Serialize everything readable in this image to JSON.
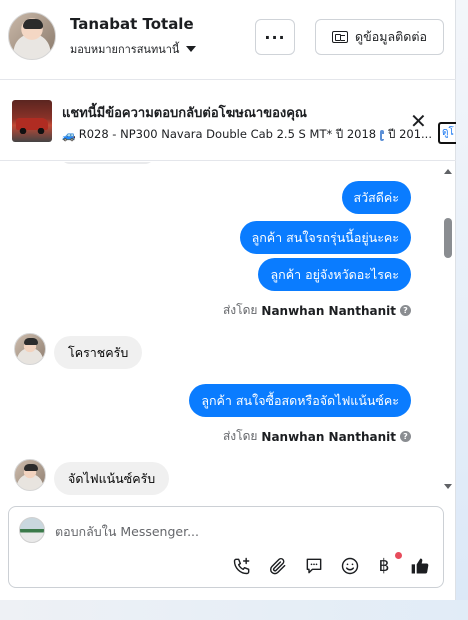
{
  "header": {
    "contact_name": "Tanabat Totale",
    "assign_label": "มอบหมายการสนทนานี้",
    "more_label": "···",
    "contact_info_label": "ดูข้อมูลติดต่อ"
  },
  "ad_banner": {
    "title": "แชทนี้มีข้อความตอบกลับต่อโฆษณาของคุณ",
    "car_emoji": "🚙",
    "detail_main": "R028 - NP300 Navara Double Cab 2.5 S MT* ปี 2018",
    "detail_tail": "ปี 201...",
    "more_tab_label": "ดูโ",
    "close_label": "✕"
  },
  "messages": [
    {
      "direction": "out",
      "text": "สวัสดีค่ะ"
    },
    {
      "direction": "out",
      "text": "ลูกค้า  สนใจรถรุ่นนี้อยู่นะคะ"
    },
    {
      "direction": "out",
      "text": "ลูกค้า  อยู่จังหวัดอะไรคะ"
    },
    {
      "direction": "in",
      "text": "โคราชครับ"
    },
    {
      "direction": "out",
      "text": "ลูกค้า  สนใจซื้อสดหรือจัดไฟแน้นซ์คะ"
    },
    {
      "direction": "in",
      "text": "จัดไฟแน้นซ์ครับ"
    }
  ],
  "sent_by": {
    "prefix": "ส่งโดย",
    "name": "Nanwhan Nanthanit",
    "info_glyph": "?"
  },
  "composer": {
    "placeholder": "ตอบกลับใน Messenger...",
    "tools": [
      "phone-plus-icon",
      "paperclip-icon",
      "saved-replies-icon",
      "emoji-icon",
      "baht-payment-icon",
      "like-icon"
    ],
    "baht_glyph": "฿"
  },
  "colors": {
    "outgoing_bubble": "#0a7cff",
    "incoming_bubble": "#f0f0f0",
    "notification_dot": "#e74c5c"
  }
}
